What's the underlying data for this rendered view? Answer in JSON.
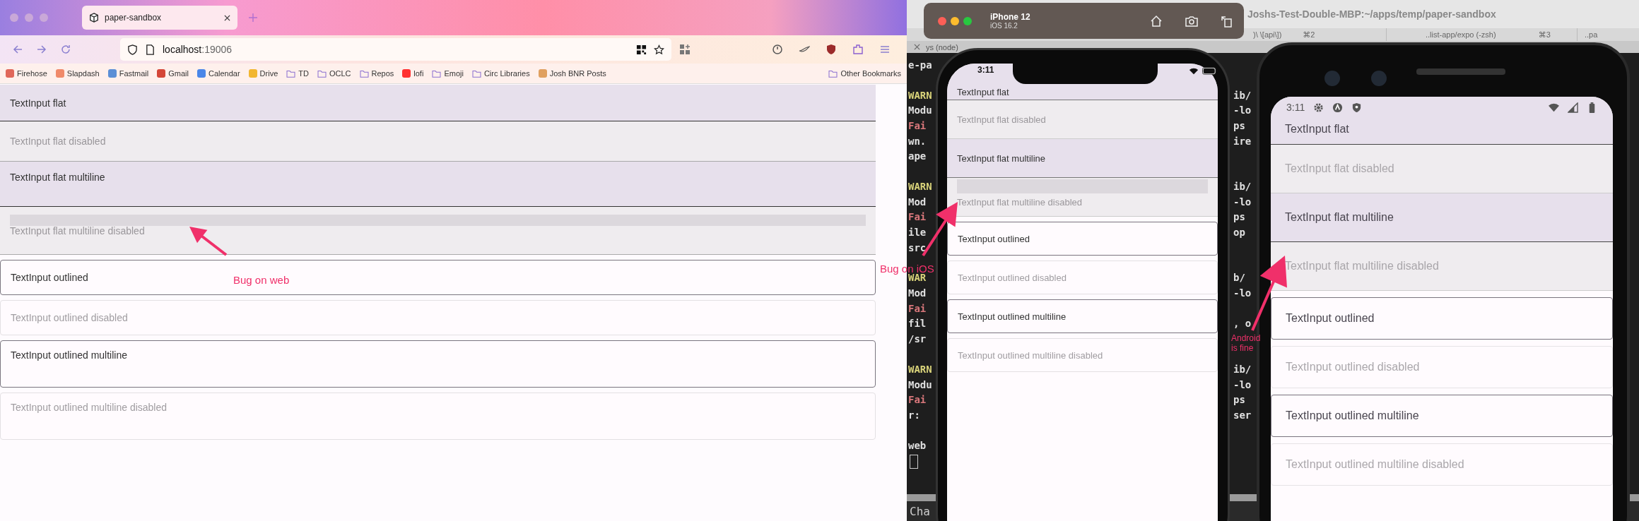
{
  "browser": {
    "tab_title": "paper-sandbox",
    "url_host": "localhost",
    "url_port": ":19006",
    "bookmarks": [
      {
        "label": "Firehose",
        "kind": "site",
        "color": "#e0675a"
      },
      {
        "label": "Slapdash",
        "kind": "site",
        "color": "#f08a6a"
      },
      {
        "label": "Fastmail",
        "kind": "site",
        "color": "#5b8fd6"
      },
      {
        "label": "Gmail",
        "kind": "site",
        "color": "#d44638"
      },
      {
        "label": "Calendar",
        "kind": "site",
        "color": "#4a86e8"
      },
      {
        "label": "Drive",
        "kind": "site",
        "color": "#f2b630"
      },
      {
        "label": "TD",
        "kind": "folder"
      },
      {
        "label": "OCLC",
        "kind": "folder"
      },
      {
        "label": "Repos",
        "kind": "folder"
      },
      {
        "label": "lofi",
        "kind": "site",
        "color": "#ff3030"
      },
      {
        "label": "Emoji",
        "kind": "folder"
      },
      {
        "label": "Circ Libraries",
        "kind": "folder"
      },
      {
        "label": "Josh BNR Posts",
        "kind": "site",
        "color": "#e0a060"
      }
    ],
    "other_bookmarks": "Other Bookmarks",
    "inputs": [
      {
        "label": "TextInput flat",
        "kind": "flat",
        "disabled": false,
        "multiline": false,
        "stray_bar": false
      },
      {
        "label": "TextInput flat disabled",
        "kind": "flat",
        "disabled": true,
        "multiline": false,
        "stray_bar": false
      },
      {
        "label": "TextInput flat multiline",
        "kind": "flat",
        "disabled": false,
        "multiline": true,
        "stray_bar": false
      },
      {
        "label": "TextInput flat multiline disabled",
        "kind": "flat",
        "disabled": true,
        "multiline": true,
        "stray_bar": true
      },
      {
        "label": "TextInput outlined",
        "kind": "outlined",
        "disabled": false,
        "multiline": false,
        "stray_bar": false
      },
      {
        "label": "TextInput outlined disabled",
        "kind": "outlined",
        "disabled": true,
        "multiline": false,
        "stray_bar": false
      },
      {
        "label": "TextInput outlined multiline",
        "kind": "outlined",
        "disabled": false,
        "multiline": true,
        "stray_bar": false
      },
      {
        "label": "TextInput outlined multiline disabled",
        "kind": "outlined",
        "disabled": true,
        "multiline": true,
        "stray_bar": false
      }
    ]
  },
  "terminal": {
    "title": "Joshs-Test-Double-MBP:~/apps/temp/paper-sandbox",
    "tabs": [
      {
        "label": ")\\ \\[api\\])",
        "shortcut": "⌘2",
        "selected": false
      },
      {
        "label": "..list-app/expo (-zsh)",
        "shortcut": "⌘3",
        "selected": false
      },
      {
        "label": "..pa",
        "selected": false
      }
    ],
    "pane_title": "ys (node)",
    "blocks": [
      [
        {
          "left": "e-pa",
          "kind": "plain"
        }
      ],
      [
        {
          "left": "WARN",
          "right": "ib/",
          "kind": "warn"
        },
        {
          "left": "Modu",
          "right": "-lo",
          "kind": "plain"
        },
        {
          "left": "Fai",
          "right": "ps",
          "kind": "error"
        },
        {
          "left": "wn.",
          "right": "ire",
          "kind": "plain"
        },
        {
          "left": "ape",
          "kind": "plain"
        }
      ],
      [
        {
          "left": "WARN",
          "right": "ib/",
          "kind": "warn"
        },
        {
          "left": "Mod",
          "right": "-lo",
          "kind": "plain"
        },
        {
          "left": "Fai",
          "right": "ps",
          "kind": "error"
        },
        {
          "left": "ile",
          "right": "op",
          "kind": "plain"
        },
        {
          "left": "src",
          "kind": "plain"
        }
      ],
      [
        {
          "left": "WAR",
          "right": "b/",
          "kind": "warn"
        },
        {
          "left": "Mod",
          "right": "-lo",
          "kind": "plain"
        },
        {
          "left": "Fai",
          "kind": "error"
        },
        {
          "left": "fil",
          "right": ", o",
          "kind": "plain"
        },
        {
          "left": "/sr",
          "kind": "plain"
        }
      ],
      [
        {
          "left": "WARN",
          "right": "ib/",
          "kind": "warn"
        },
        {
          "left": "Modu",
          "right": "-lo",
          "kind": "plain"
        },
        {
          "left": "Fai",
          "right": "ps",
          "kind": "error"
        },
        {
          "left": "r:",
          "right": "ser",
          "kind": "plain"
        }
      ],
      [
        {
          "left": "web",
          "kind": "plain"
        }
      ]
    ],
    "bottom": "Cha"
  },
  "simulator": {
    "device": "iPhone 12",
    "os": "iOS 16.2"
  },
  "ios": {
    "time": "3:11",
    "inputs": [
      {
        "label": "TextInput flat",
        "kind": "flat",
        "disabled": false,
        "stray_bar": false
      },
      {
        "label": "TextInput flat disabled",
        "kind": "flat",
        "disabled": true,
        "stray_bar": false
      },
      {
        "label": "TextInput flat multiline",
        "kind": "flat",
        "disabled": false,
        "stray_bar": false
      },
      {
        "label": "TextInput flat multiline disabled",
        "kind": "flat",
        "disabled": true,
        "stray_bar": true
      },
      {
        "label": "TextInput outlined",
        "kind": "outlined",
        "disabled": false,
        "stray_bar": false
      },
      {
        "label": "TextInput outlined disabled",
        "kind": "outlined",
        "disabled": true,
        "stray_bar": false
      },
      {
        "label": "TextInput outlined multiline",
        "kind": "outlined",
        "disabled": false,
        "stray_bar": false
      },
      {
        "label": "TextInput outlined multiline disabled",
        "kind": "outlined",
        "disabled": true,
        "stray_bar": false
      }
    ]
  },
  "android": {
    "time": "3:11",
    "inputs": [
      {
        "label": "TextInput flat",
        "kind": "flat",
        "disabled": false
      },
      {
        "label": "TextInput flat disabled",
        "kind": "flat",
        "disabled": true
      },
      {
        "label": "TextInput flat multiline",
        "kind": "flat",
        "disabled": false
      },
      {
        "label": "TextInput flat multiline disabled",
        "kind": "flat",
        "disabled": true
      },
      {
        "label": "TextInput outlined",
        "kind": "outlined",
        "disabled": false
      },
      {
        "label": "TextInput outlined disabled",
        "kind": "outlined",
        "disabled": true
      },
      {
        "label": "TextInput outlined multiline",
        "kind": "outlined",
        "disabled": false
      },
      {
        "label": "TextInput outlined multiline disabled",
        "kind": "outlined",
        "disabled": true
      }
    ]
  },
  "annotations": [
    {
      "text": "Bug on web"
    },
    {
      "text": "Bug on iOS"
    },
    {
      "text": "Android is fine"
    }
  ]
}
